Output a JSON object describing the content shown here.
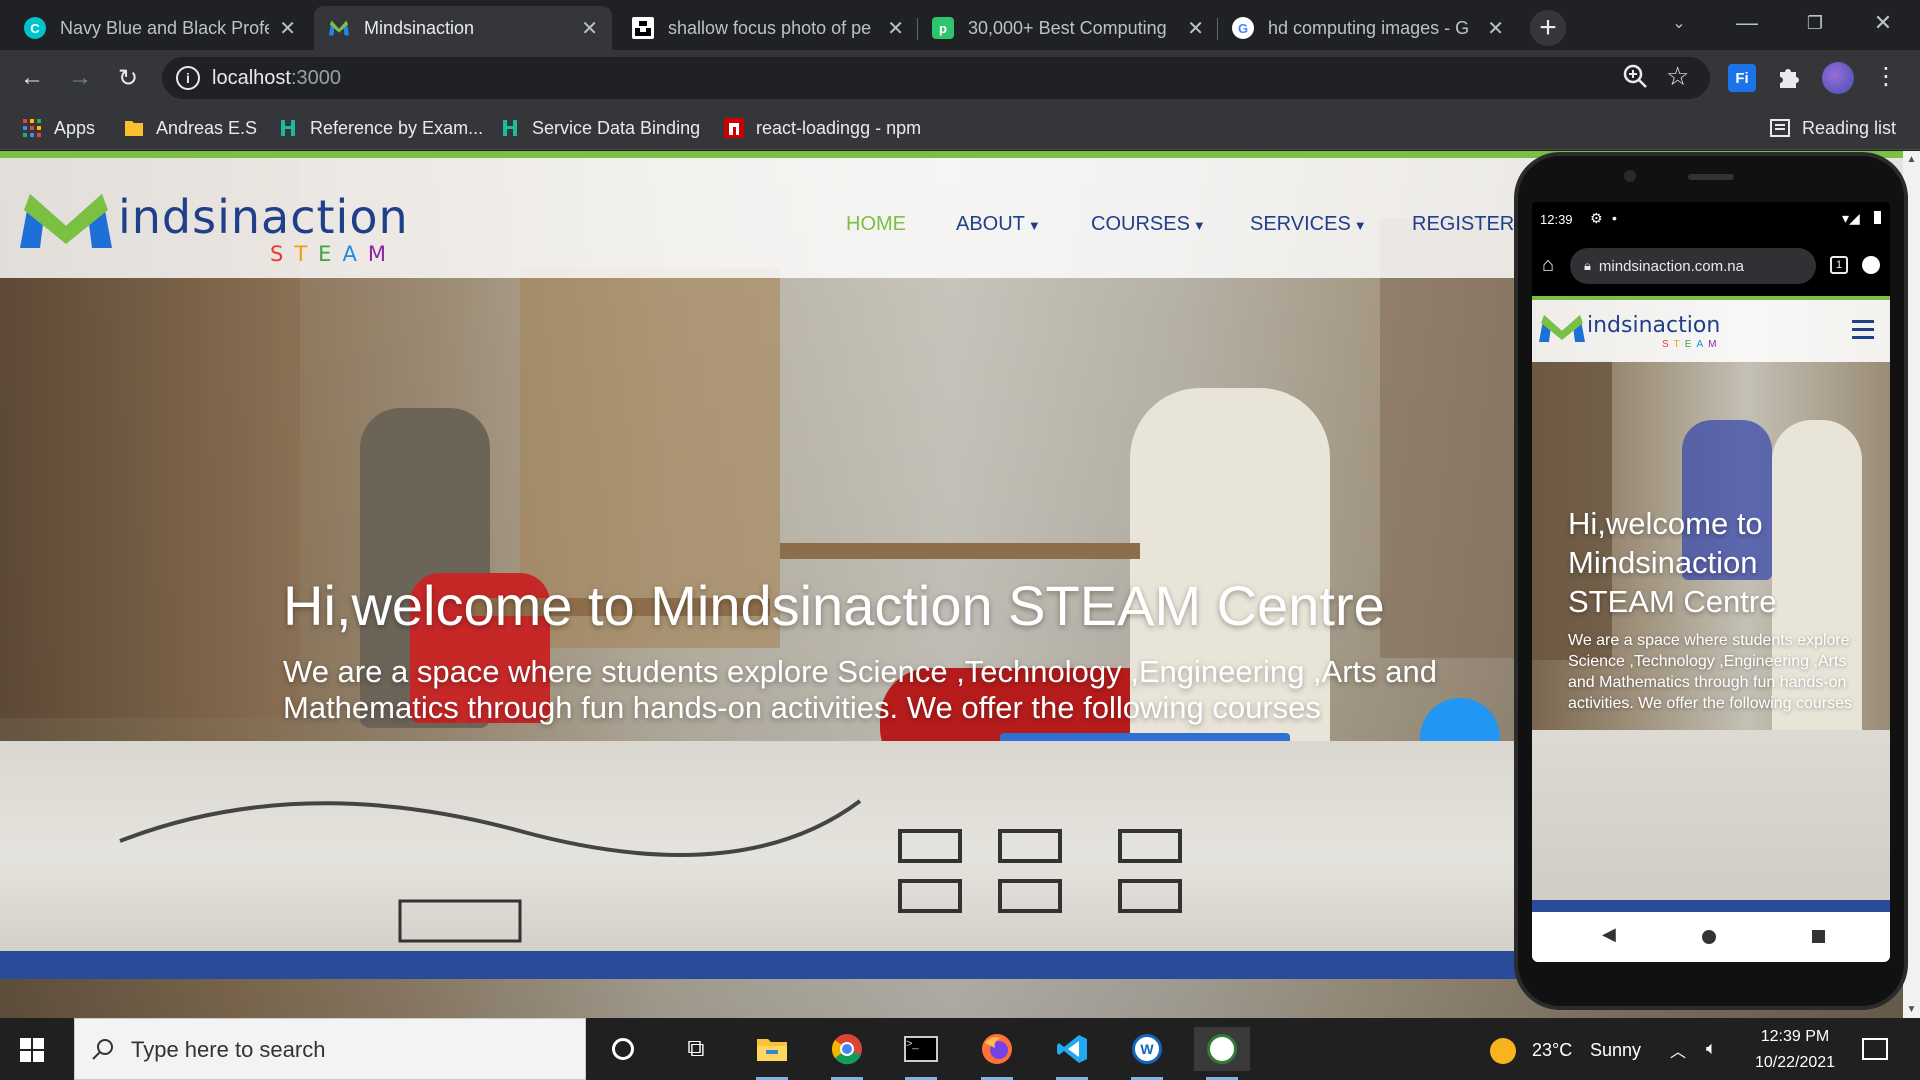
{
  "browser": {
    "tabs": [
      {
        "title": "Navy Blue and Black Profe",
        "favicon": "canva-icon"
      },
      {
        "title": "Mindsinaction",
        "favicon": "mindsinaction-icon"
      },
      {
        "title": "shallow focus photo of pe",
        "favicon": "unsplash-icon"
      },
      {
        "title": "30,000+ Best Computing",
        "favicon": "pixabay-icon"
      },
      {
        "title": "hd computing images - G",
        "favicon": "google-icon"
      }
    ],
    "url_host": "localhost",
    "url_port": ":3000",
    "bookmarks": [
      {
        "label": "Apps",
        "icon": "apps-grid-icon"
      },
      {
        "label": "Andreas E.S",
        "icon": "folder-icon"
      },
      {
        "label": "Reference by Exam...",
        "icon": "vuetify-icon"
      },
      {
        "label": "Service Data Binding",
        "icon": "vuetify-icon"
      },
      {
        "label": "react-loadingg - npm",
        "icon": "npm-icon"
      }
    ],
    "reading_list": "Reading list"
  },
  "site": {
    "logo_main": "indsinaction",
    "logo_steam": [
      "S",
      "T",
      "E",
      "A",
      "M"
    ],
    "nav": [
      {
        "label": "HOME",
        "dropdown": false,
        "active": true
      },
      {
        "label": "ABOUT",
        "dropdown": true,
        "active": false
      },
      {
        "label": "COURSES",
        "dropdown": true,
        "active": false
      },
      {
        "label": "SERVICES",
        "dropdown": true,
        "active": false
      },
      {
        "label": "REGISTER",
        "dropdown": false,
        "active": false
      }
    ],
    "hero_title": "Hi,welcome to Mindsinaction STEAM Centre",
    "hero_subtitle": "We are a space where students explore Science ,Technology ,Engineering ,Arts and Mathematics through fun hands-on activities. We offer the following courses",
    "colors": {
      "brand_green": "#7ac143",
      "brand_blue": "#1f3f8a",
      "steam_s": "#e53935",
      "steam_t": "#f39c12",
      "steam_e": "#43a047",
      "steam_a": "#1e88e5",
      "steam_m": "#8e24aa"
    }
  },
  "phone": {
    "time": "12:39",
    "url": "mindsinaction.com.na",
    "tab_count": "1",
    "hero_title": "Hi,welcome to Mindsinaction STEAM Centre",
    "hero_subtitle": "We are a space where students explore Science ,Technology ,Engineering ,Arts and Mathematics through fun hands-on activities. We offer the following courses"
  },
  "taskbar": {
    "search_placeholder": "Type here to search",
    "weather_temp": "23°C",
    "weather_text": "Sunny",
    "time": "12:39 PM",
    "date": "10/22/2021"
  }
}
